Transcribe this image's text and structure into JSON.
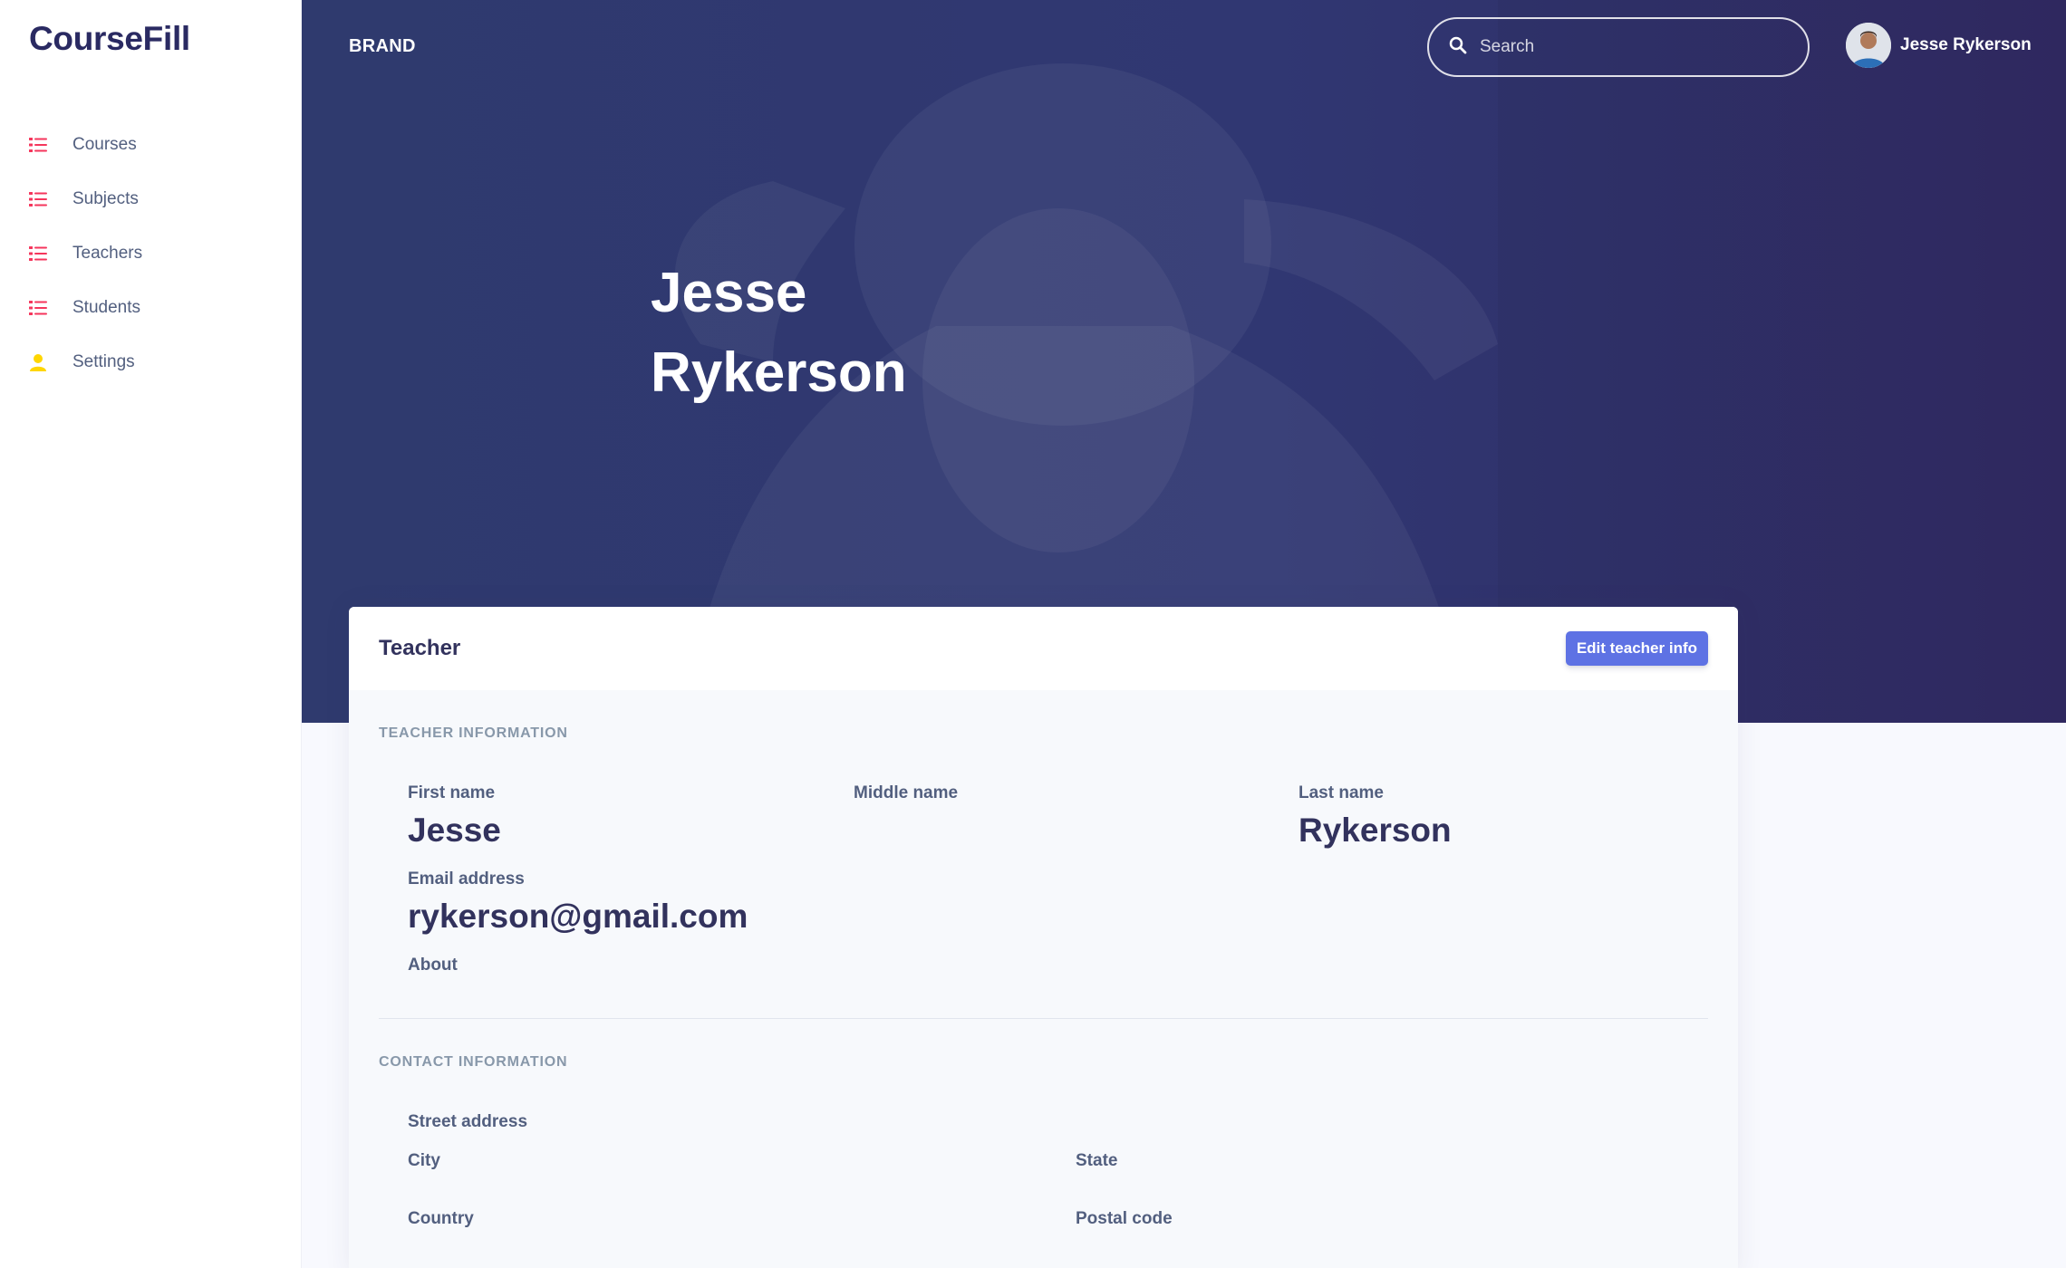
{
  "app": {
    "logo": "CourseFill"
  },
  "sidebar": {
    "items": [
      {
        "label": "Courses",
        "icon": "list-icon",
        "color": "#f5365c"
      },
      {
        "label": "Subjects",
        "icon": "list-icon",
        "color": "#f5365c"
      },
      {
        "label": "Teachers",
        "icon": "list-icon",
        "color": "#f5365c"
      },
      {
        "label": "Students",
        "icon": "list-icon",
        "color": "#f5365c"
      },
      {
        "label": "Settings",
        "icon": "user-icon",
        "color": "#ffd600"
      }
    ]
  },
  "header": {
    "brand": "BRAND",
    "search_placeholder": "Search",
    "user_name": "Jesse Rykerson"
  },
  "hero": {
    "first_name": "Jesse",
    "last_name": "Rykerson"
  },
  "card": {
    "title": "Teacher",
    "edit_label": "Edit teacher info",
    "teacher_section": {
      "heading": "TEACHER INFORMATION",
      "first_name_label": "First name",
      "first_name": "Jesse",
      "middle_name_label": "Middle name",
      "middle_name": "",
      "last_name_label": "Last name",
      "last_name": "Rykerson",
      "email_label": "Email address",
      "email": "rykerson@gmail.com",
      "about_label": "About"
    },
    "contact_section": {
      "heading": "CONTACT INFORMATION",
      "street_label": "Street address",
      "city_label": "City",
      "state_label": "State",
      "country_label": "Country",
      "postal_label": "Postal code"
    }
  },
  "colors": {
    "accent": "#5e72e4",
    "hero": "#2f3a6e",
    "nav_icon": "#f5365c",
    "settings_icon": "#ffd600"
  }
}
